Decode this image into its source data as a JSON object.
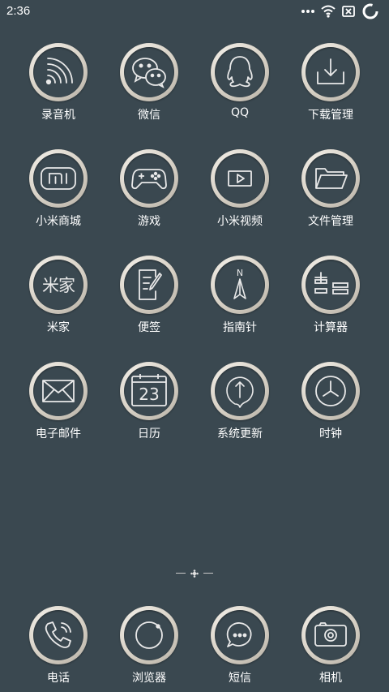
{
  "status_bar": {
    "time": "2:36",
    "icons": [
      "more-dots-icon",
      "wifi-icon",
      "sim-missing-icon",
      "sync-icon"
    ]
  },
  "theme": {
    "background": "#3a4850",
    "ring": "#d9d3c8",
    "icon_stroke": "#e9e9e9",
    "label": "#ffffff"
  },
  "apps": [
    {
      "label": "录音机",
      "icon": "recorder-icon"
    },
    {
      "label": "微信",
      "icon": "wechat-icon"
    },
    {
      "label": "QQ",
      "icon": "qq-icon"
    },
    {
      "label": "下载管理",
      "icon": "download-icon"
    },
    {
      "label": "小米商城",
      "icon": "mi-store-icon"
    },
    {
      "label": "游戏",
      "icon": "gamepad-icon"
    },
    {
      "label": "小米视频",
      "icon": "video-icon"
    },
    {
      "label": "文件管理",
      "icon": "folder-icon"
    },
    {
      "label": "米家",
      "icon": "mijia-icon",
      "icon_text": "米家"
    },
    {
      "label": "便签",
      "icon": "notes-icon"
    },
    {
      "label": "指南针",
      "icon": "compass-icon",
      "icon_text": "N"
    },
    {
      "label": "计算器",
      "icon": "calculator-icon"
    },
    {
      "label": "电子邮件",
      "icon": "mail-icon"
    },
    {
      "label": "日历",
      "icon": "calendar-icon",
      "icon_text": "23"
    },
    {
      "label": "系统更新",
      "icon": "update-icon"
    },
    {
      "label": "时钟",
      "icon": "clock-icon"
    }
  ],
  "dock": [
    {
      "label": "电话",
      "icon": "phone-icon"
    },
    {
      "label": "浏览器",
      "icon": "browser-icon"
    },
    {
      "label": "短信",
      "icon": "message-icon"
    },
    {
      "label": "相机",
      "icon": "camera-icon"
    }
  ]
}
